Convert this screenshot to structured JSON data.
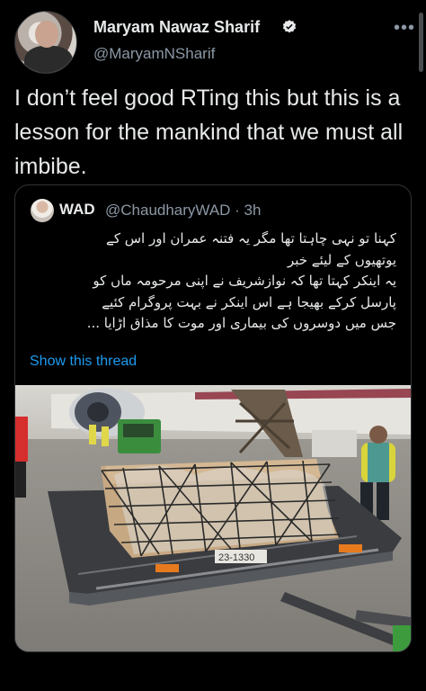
{
  "tweet": {
    "author_name": "Maryam Nawaz Sharif",
    "author_handle": "@MaryamNSharif",
    "verified": true,
    "more_icon": "•••",
    "text": "I don’t feel good RTing this but this is a lesson for the mankind that we must all imbibe."
  },
  "quoted_tweet": {
    "author_name": "WAD",
    "author_handle": "@ChaudharyWAD · 3h",
    "lines": [
      "کہنا تو نہی چاہتا تھا مگر یہ فتنہ عمران اور اس کے",
      "یوتھیوں کے لیئے خبر",
      "یہ اینکر کہتا تھا کہ نوازشریف نے اپنی مرحومہ ماں کو",
      "پارسل کرکے بھیجا ہے اس اینکر نے بہت پروگرام کئیے",
      "جس میں دوسروں کی بیماری اور موت کا مذاق اڑایا ..."
    ],
    "show_thread": "Show this thread",
    "photo_text": "23-1330"
  },
  "colors": {
    "background": "#000000",
    "text": "#e7e9ea",
    "secondary": "#8b98a5",
    "link": "#1d9bf0",
    "border": "#2f3336"
  }
}
